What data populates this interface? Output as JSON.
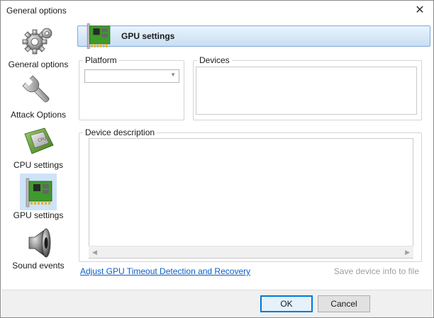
{
  "window": {
    "title": "General options"
  },
  "sidebar": {
    "items": [
      {
        "label": "General options",
        "icon": "gear-icon"
      },
      {
        "label": "Attack Options",
        "icon": "wrench-icon"
      },
      {
        "label": "CPU settings",
        "icon": "cpu-chip-icon"
      },
      {
        "label": "GPU settings",
        "icon": "gpu-card-icon",
        "active": true
      },
      {
        "label": "Sound events",
        "icon": "speaker-icon"
      }
    ]
  },
  "panel": {
    "title": "GPU settings",
    "icon": "gpu-card-icon",
    "platform": {
      "label": "Platform",
      "value": ""
    },
    "devices": {
      "label": "Devices"
    },
    "device_description": {
      "label": "Device description"
    },
    "link": "Adjust GPU Timeout Detection and Recovery",
    "save_info": "Save device info to file"
  },
  "buttons": {
    "ok": "OK",
    "cancel": "Cancel"
  },
  "colors": {
    "accent": "#0078d7",
    "link": "#0b5ec9",
    "header_border": "#7fa9d4",
    "active_bg": "#cfe3f7",
    "disabled_text": "#a0a0a0"
  }
}
